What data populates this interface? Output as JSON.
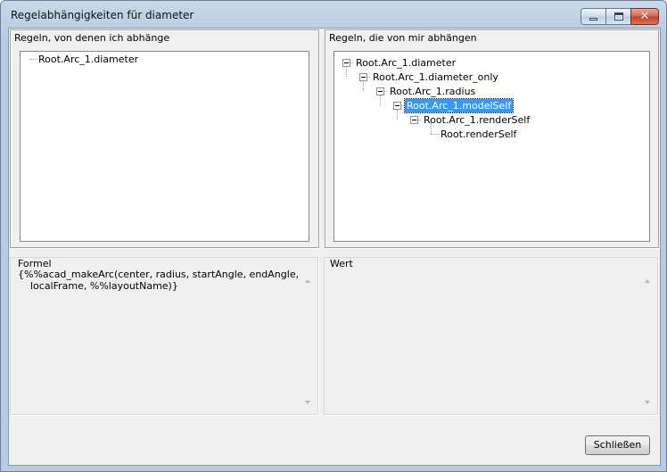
{
  "window": {
    "title": "Regelabhängigkeiten für diameter"
  },
  "left_panel": {
    "label": "Regeln, von denen ich abhänge",
    "nodes": [
      {
        "label": "Root.Arc_1.diameter"
      }
    ]
  },
  "right_panel": {
    "label": "Regeln, die von mir abhängen",
    "nodes": [
      {
        "label": "Root.Arc_1.diameter",
        "expanded": true
      },
      {
        "label": "Root.Arc_1.diameter_only",
        "expanded": true
      },
      {
        "label": "Root.Arc_1.radius",
        "expanded": true
      },
      {
        "label": "Root.Arc_1.modelSelf",
        "expanded": true,
        "selected": true
      },
      {
        "label": "Root.Arc_1.renderSelf",
        "expanded": true
      },
      {
        "label": "Root.renderSelf",
        "expanded": false
      }
    ]
  },
  "formula": {
    "label": "Formel",
    "lines": [
      "{%%acad_makeArc(center, radius, startAngle, endAngle, _",
      "    localFrame, %%layoutName)}"
    ]
  },
  "value": {
    "label": "Wert",
    "text": ""
  },
  "buttons": {
    "close_label": "Schließen"
  },
  "colors": {
    "selection": "#3399ff",
    "dialog_bg": "#f0f0f0"
  }
}
